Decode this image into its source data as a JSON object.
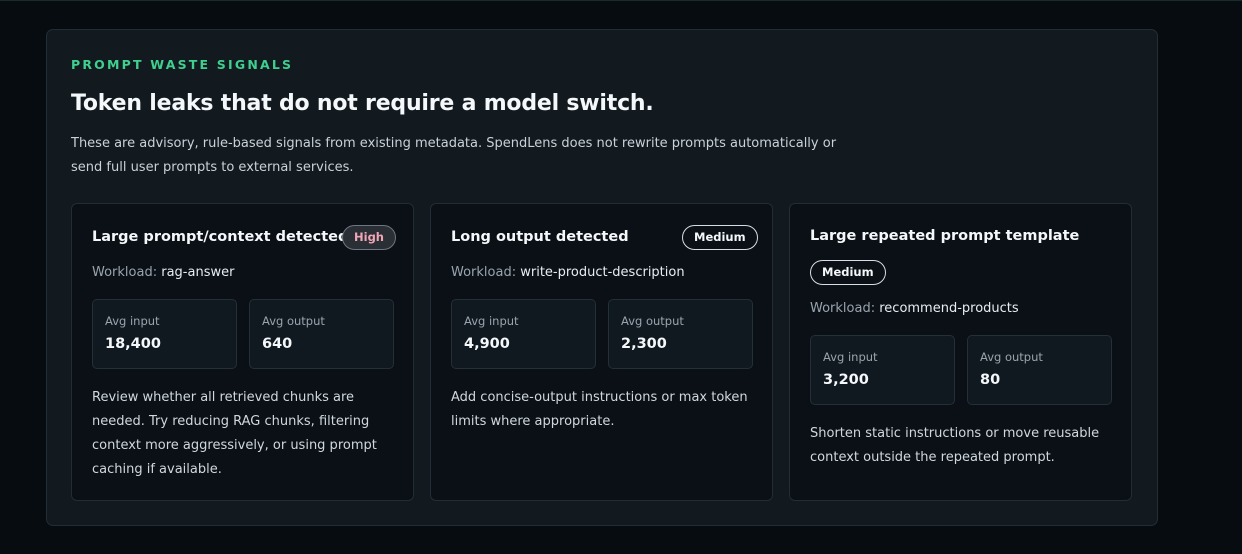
{
  "section": {
    "eyebrow": "PROMPT WASTE SIGNALS",
    "headline": "Token leaks that do not require a model switch.",
    "intro": "These are advisory, rule-based signals from existing metadata. SpendLens does not rewrite prompts automatically or send full user prompts to external services."
  },
  "colors": {
    "accent": "#3fcf8e",
    "high_badge_text": "#f0a6b5",
    "panel_bg": "#121a20",
    "card_bg": "#0a1015"
  },
  "workload_label": "Workload:",
  "cards": [
    {
      "title": "Large prompt/context detected",
      "severity": "High",
      "workload": "rag-answer",
      "avg_input_label": "Avg input",
      "avg_input": "18,400",
      "avg_output_label": "Avg output",
      "avg_output": "640",
      "advice": "Review whether all retrieved chunks are needed. Try reducing RAG chunks, filtering context more aggressively, or using prompt caching if available."
    },
    {
      "title": "Long output detected",
      "severity": "Medium",
      "workload": "write-product-description",
      "avg_input_label": "Avg input",
      "avg_input": "4,900",
      "avg_output_label": "Avg output",
      "avg_output": "2,300",
      "advice": "Add concise-output instructions or max token limits where appropriate."
    },
    {
      "title": "Large repeated prompt template",
      "severity": "Medium",
      "workload": "recommend-products",
      "avg_input_label": "Avg input",
      "avg_input": "3,200",
      "avg_output_label": "Avg output",
      "avg_output": "80",
      "advice": "Shorten static instructions or move reusable context outside the repeated prompt."
    }
  ]
}
